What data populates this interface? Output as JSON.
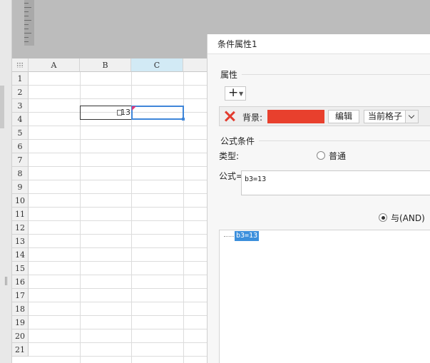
{
  "sheet": {
    "columns": [
      "A",
      "B",
      "C"
    ],
    "rows": [
      "1",
      "2",
      "3",
      "4",
      "5",
      "6",
      "7",
      "8",
      "9",
      "10",
      "11",
      "12",
      "13",
      "14",
      "15",
      "16",
      "17",
      "18",
      "19",
      "20",
      "21"
    ],
    "selected_column": "C",
    "cell_b3_value": "13"
  },
  "dialog": {
    "title": "条件属性1",
    "properties_label": "属性",
    "add_button_label": "+",
    "background_label": "背景:",
    "background_color": "#e8402d",
    "edit_button": "编辑",
    "scope_value": "当前格子",
    "formula_section_label": "公式条件",
    "type_label": "类型:",
    "type_option_normal": "普通",
    "formula_label": "公式=",
    "formula_value": "b3=13",
    "logic_option": "与(AND)",
    "conditions": [
      "b3=13"
    ]
  }
}
